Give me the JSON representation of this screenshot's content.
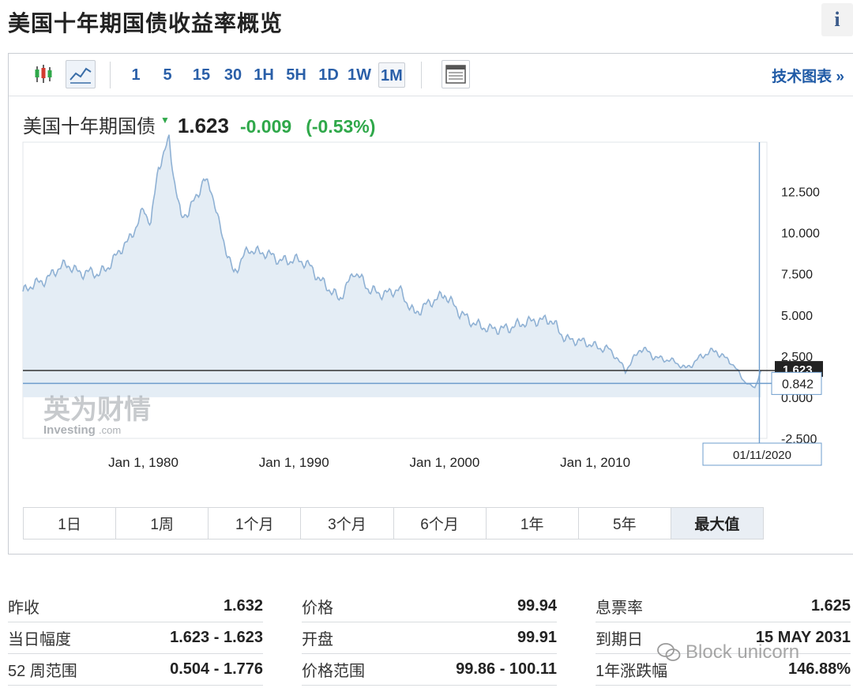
{
  "page": {
    "title": "美国十年期国债收益率概览",
    "info_label": "i"
  },
  "toolbar": {
    "intervals": [
      "1",
      "5",
      "15",
      "30",
      "1H",
      "5H",
      "1D",
      "1W",
      "1M"
    ],
    "active_interval": "1M",
    "tech_chart_link": "技术图表 »"
  },
  "quote": {
    "name": "美国十年期国债",
    "price": "1.623",
    "change": "-0.009",
    "change_pct": "(-0.53%)",
    "change_color": "#2fa84a"
  },
  "chart": {
    "crosshair_value": "0.842",
    "crosshair_date": "01/11/2020",
    "last_value_tag": "1.623",
    "watermark_cn": "英为财情",
    "watermark_en": "Investing",
    "watermark_en_suffix": ".com",
    "x_ticks": [
      "Jan 1, 1980",
      "Jan 1, 1990",
      "Jan 1, 2000",
      "Jan 1, 2010"
    ],
    "y_ticks": [
      "12.500",
      "10.000",
      "7.500",
      "5.000",
      "2.500",
      "0.000",
      "-2.500"
    ]
  },
  "chart_data": {
    "type": "area",
    "title": "美国十年期国债",
    "x": [
      1972,
      1973,
      1974,
      1975,
      1976,
      1977,
      1978,
      1979,
      1980,
      1980.5,
      1981,
      1981.7,
      1982,
      1982.5,
      1983,
      1984,
      1984.5,
      1985,
      1986,
      1987,
      1988,
      1989,
      1990,
      1991,
      1992,
      1993,
      1994,
      1995,
      1996,
      1997,
      1998,
      1999,
      2000,
      2001,
      2002,
      2003,
      2004,
      2005,
      2006,
      2007,
      2008,
      2009,
      2010,
      2011,
      2012,
      2013,
      2014,
      2015,
      2016,
      2017,
      2018,
      2019,
      2020,
      2020.6,
      2021
    ],
    "y": [
      6.4,
      6.9,
      7.6,
      8.0,
      7.6,
      7.4,
      8.4,
      9.4,
      11.5,
      10.5,
      13.9,
      15.8,
      13.6,
      10.8,
      11.2,
      13.3,
      12.6,
      10.5,
      7.6,
      8.9,
      8.9,
      8.2,
      8.5,
      7.9,
      7.0,
      5.8,
      7.8,
      6.4,
      6.4,
      6.4,
      5.2,
      5.6,
      6.4,
      5.0,
      4.6,
      4.0,
      4.3,
      4.3,
      4.8,
      4.6,
      3.7,
      3.3,
      3.2,
      2.8,
      1.7,
      2.9,
      2.5,
      2.2,
      1.8,
      2.4,
      2.9,
      2.1,
      0.9,
      0.6,
      1.62
    ],
    "ylim": [
      -2.5,
      15.5
    ],
    "xlim": [
      1972,
      2021.4
    ],
    "grid": false,
    "color": "#8fb1d4",
    "fill": "#e4edf5"
  },
  "range_buttons": [
    "1日",
    "1周",
    "1个月",
    "3个月",
    "6个月",
    "1年",
    "5年",
    "最大值"
  ],
  "active_range": "最大值",
  "stats": {
    "col1": [
      {
        "label": "昨收",
        "value": "1.632"
      },
      {
        "label": "当日幅度",
        "value": "1.623 - 1.623"
      },
      {
        "label": "52 周范围",
        "value": "0.504 - 1.776"
      }
    ],
    "col2": [
      {
        "label": "价格",
        "value": "99.94"
      },
      {
        "label": "开盘",
        "value": "99.91"
      },
      {
        "label": "价格范围",
        "value": "99.86 - 100.11"
      }
    ],
    "col3": [
      {
        "label": "息票率",
        "value": "1.625"
      },
      {
        "label": "到期日",
        "value": "15 MAY 2031"
      },
      {
        "label": "1年涨跌幅",
        "value": "146.88%"
      }
    ]
  },
  "footer_watermark": "Block unicorn"
}
